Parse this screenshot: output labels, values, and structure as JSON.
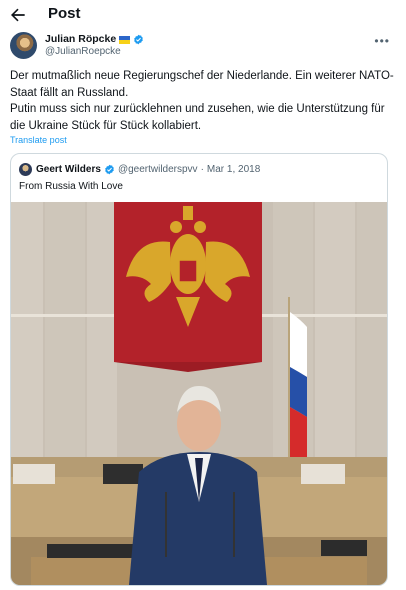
{
  "header": {
    "title": "Post"
  },
  "author": {
    "name": "Julian Röpcke",
    "handle": "@JulianRoepcke"
  },
  "tweet": {
    "lines": [
      "Der mutmaßlich neue Regierungschef der Niederlande. Ein weiterer NATO-Staat fällt an Russland.",
      "Putin muss sich nur zurücklehnen und zusehen, wie die Unterstützung für die Ukraine Stück für Stück kollabiert."
    ],
    "translate_label": "Translate post"
  },
  "quote": {
    "author_name": "Geert Wilders",
    "author_handle": "@geertwilderspvv",
    "separator": "·",
    "date": "Mar 1, 2018",
    "text": "From Russia With Love"
  },
  "colors": {
    "accent": "#1d9bf0",
    "text_primary": "#0f1419",
    "text_secondary": "#536471",
    "border": "#cfd9de"
  },
  "icons": {
    "back": "arrow-left-icon",
    "verified": "verified-badge-icon",
    "more": "more-horizontal-icon",
    "flag": "ukraine-flag-icon"
  }
}
